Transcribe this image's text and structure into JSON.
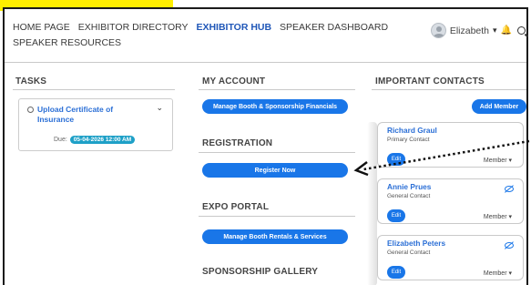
{
  "nav": {
    "items": [
      "HOME PAGE",
      "EXHIBITOR DIRECTORY",
      "EXHIBITOR HUB",
      "SPEAKER DASHBOARD",
      "SPEAKER RESOURCES"
    ],
    "active": "EXHIBITOR HUB"
  },
  "user": {
    "name": "Elizabeth",
    "avatar_icon": "avatar-icon",
    "dropdown_icon": "caret-down-icon",
    "bell_icon": "bell-icon",
    "search_icon": "search-icon"
  },
  "tasks": {
    "title": "TASKS",
    "items": [
      {
        "title": "Upload Certificate of Insurance",
        "due_label": "Due:",
        "due_value": "05-04-2026 12:00 AM"
      }
    ]
  },
  "account": {
    "title": "MY ACCOUNT",
    "button": "Manage Booth & Sponsorship Financials"
  },
  "registration": {
    "title": "REGISTRATION",
    "button": "Register Now"
  },
  "expo": {
    "title": "EXPO PORTAL",
    "button": "Manage Booth Rentals & Services"
  },
  "sponsorship": {
    "title": "SPONSORSHIP GALLERY"
  },
  "contacts": {
    "title": "IMPORTANT CONTACTS",
    "add_button": "Add Member",
    "items": [
      {
        "name": "Richard Graul",
        "role": "Primary Contact",
        "edit": "Edit",
        "member": "Member ▾"
      },
      {
        "name": "Annie Prues",
        "role": "General Contact",
        "edit": "Edit",
        "member": "Member ▾"
      },
      {
        "name": "Elizabeth Peters",
        "role": "General Contact",
        "edit": "Edit",
        "member": "Member ▾"
      }
    ]
  },
  "colors": {
    "accent": "#1976e8",
    "link": "#2b6fd6",
    "highlight": "#ffee00",
    "badge": "#1ea0c7"
  }
}
